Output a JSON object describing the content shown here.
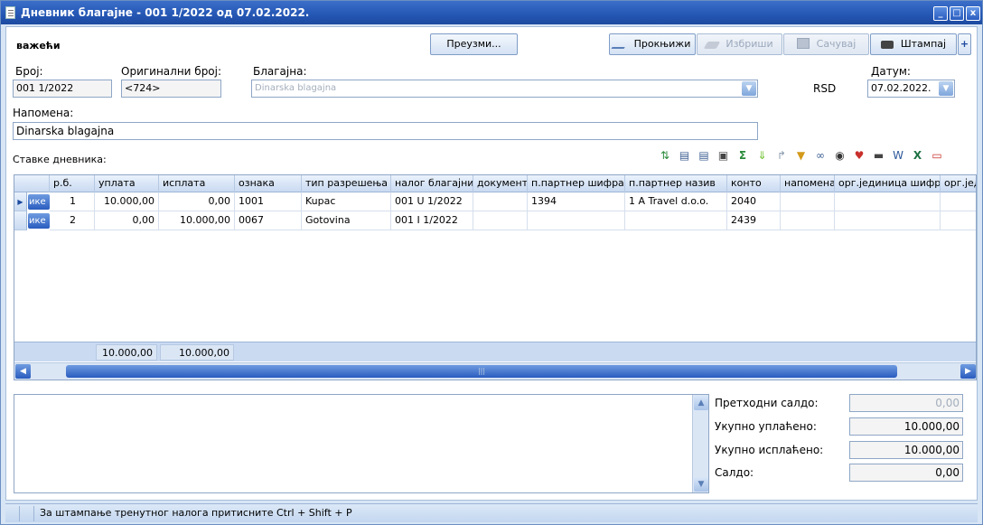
{
  "window": {
    "title": "Дневник благајне - 001 1/2022 од 07.02.2022.",
    "min_label": "_",
    "max_label": "□",
    "close_label": "x"
  },
  "status_label": "важећи",
  "buttons": {
    "take": "Преузми...",
    "post": "Прокњижи",
    "delete": "Избриши",
    "save": "Сачувај",
    "print": "Штампај",
    "plus": "+"
  },
  "form": {
    "broj_label": "Број:",
    "broj_value": "001 1/2022",
    "orig_label": "Оригинални број:",
    "orig_value": "<724>",
    "blagajna_label": "Благајна:",
    "blagajna_value": "Dinarska blagajna",
    "currency": "RSD",
    "datum_label": "Датум:",
    "datum_value": "07.02.2022.",
    "napomena_label": "Напомена:",
    "napomena_value": "Dinarska blagajna"
  },
  "grid_title": "Ставке дневника:",
  "grid": {
    "columns": [
      "р.б.",
      "уплата",
      "исплата",
      "ознака",
      "тип разрешења",
      "налог благајни",
      "документ",
      "п.партнер шифра",
      "п.партнер назив",
      "конто",
      "напомена",
      "орг.јединица шифра",
      "орг.јед"
    ],
    "row_button_label": "ике",
    "rows": [
      [
        "1",
        "10.000,00",
        "0,00",
        "1001",
        "Kupac",
        "001 U 1/2022",
        "",
        "1394",
        "1 A Travel d.o.o.",
        "2040",
        "",
        "",
        ""
      ],
      [
        "2",
        "0,00",
        "10.000,00",
        "0067",
        "Gotovina",
        "001 I 1/2022",
        "",
        "",
        "",
        "2439",
        "",
        "",
        ""
      ]
    ],
    "totals": {
      "uplata": "10.000,00",
      "isplata": "10.000,00"
    }
  },
  "summary": {
    "prethodni_label": "Претходни салдо:",
    "prethodni_value": "0,00",
    "uplaceno_label": "Укупно уплаћено:",
    "uplaceno_value": "10.000,00",
    "isplaceno_label": "Укупно исплаћено:",
    "isplaceno_value": "10.000,00",
    "saldo_label": "Салдо:",
    "saldo_value": "0,00"
  },
  "statusbar_text": "За штампање тренутног налога притисните Ctrl + Shift + P",
  "colors": {
    "title_bar": "#2456b4",
    "window_bg": "#d7e5f5"
  }
}
